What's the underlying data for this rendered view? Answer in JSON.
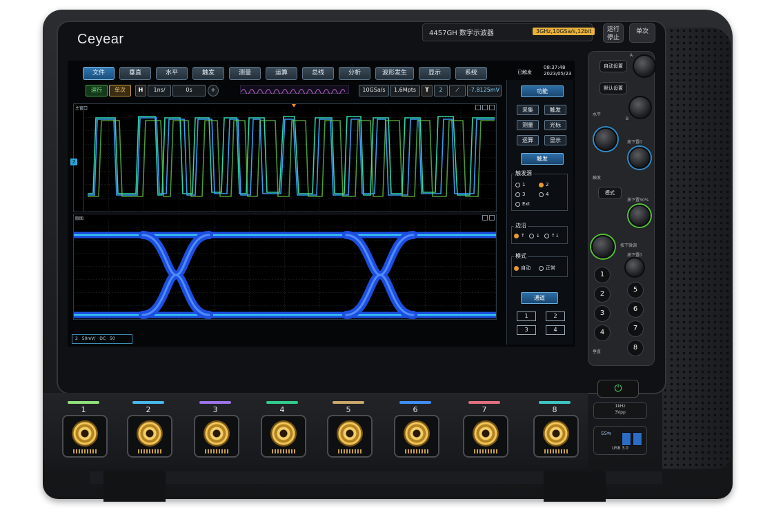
{
  "device": {
    "logo": "Ceyear",
    "model": "4457GH 数字示波器",
    "spec_badge": "3GHz,10GSa/s,12bit",
    "run_stop_label": "运行\n停止",
    "single_label": "单次"
  },
  "menu": [
    "文件",
    "垂直",
    "水平",
    "触发",
    "测量",
    "运算",
    "总线",
    "分析",
    "波形发生",
    "显示",
    "系统"
  ],
  "status": {
    "trigger_state": "已触发",
    "time": "08:37:48",
    "date": "2023/05/23"
  },
  "control_bar": {
    "run": "运行",
    "single": "单次",
    "h_label": "H",
    "timebase": "1ns/",
    "offset": "0s",
    "sample_rate": "10GSa/s",
    "memory_depth": "1.6Mpts",
    "t_label": "T",
    "trigger_channel": "2",
    "trigger_level": "-7.8125mV"
  },
  "panes": {
    "main_title": "主窗口",
    "eye_title": "眼图"
  },
  "channel_box": {
    "channel": "2",
    "scale": "50mV/",
    "coupling": "DC",
    "impedance": "50"
  },
  "side_menu": {
    "function_header": "功能",
    "function_buttons": [
      "采集",
      "触发",
      "测量",
      "光标",
      "运算",
      "显示"
    ],
    "trigger_header": "触发",
    "trigger_source_label": "触发源",
    "trigger_sources": [
      "1",
      "2",
      "3",
      "4",
      "Ext"
    ],
    "selected_source": "2",
    "edge_label": "边沿",
    "edge_options": [
      "↑",
      "↓",
      "↑↓"
    ],
    "mode_label": "模式",
    "mode_options": [
      "自动",
      "正常"
    ],
    "selected_mode": "自动",
    "channel_header": "通道",
    "channels": [
      "1",
      "2",
      "3",
      "4"
    ]
  },
  "panel": {
    "auto_setup": "自动设置",
    "default_setup": "默认设置",
    "mode": "模式",
    "horizontal_label": "水平",
    "trigger_label": "触发",
    "vertical_label": "垂直",
    "press_zero": "按下置0",
    "press_50": "按下置50%",
    "press_fine": "按下微调",
    "numbers": [
      "1",
      "2",
      "3",
      "4",
      "5",
      "6",
      "7",
      "8"
    ],
    "letter_a": "A",
    "letter_b": "B"
  },
  "inputs": [
    {
      "num": "1",
      "color": "#8fe07a"
    },
    {
      "num": "2",
      "color": "#49b8ea"
    },
    {
      "num": "3",
      "color": "#9b73e8"
    },
    {
      "num": "4",
      "color": "#2fcc8c"
    },
    {
      "num": "5",
      "color": "#c9a86a"
    },
    {
      "num": "6",
      "color": "#3f8ff0"
    },
    {
      "num": "7",
      "color": "#e0707f"
    },
    {
      "num": "8",
      "color": "#3fc4c4"
    }
  ],
  "power_icon": "power-icon",
  "calibration": {
    "freq": "1kHz",
    "amp": "3Vpp"
  },
  "usb": {
    "label": "USB 3.0",
    "logo": "SS⇆"
  }
}
